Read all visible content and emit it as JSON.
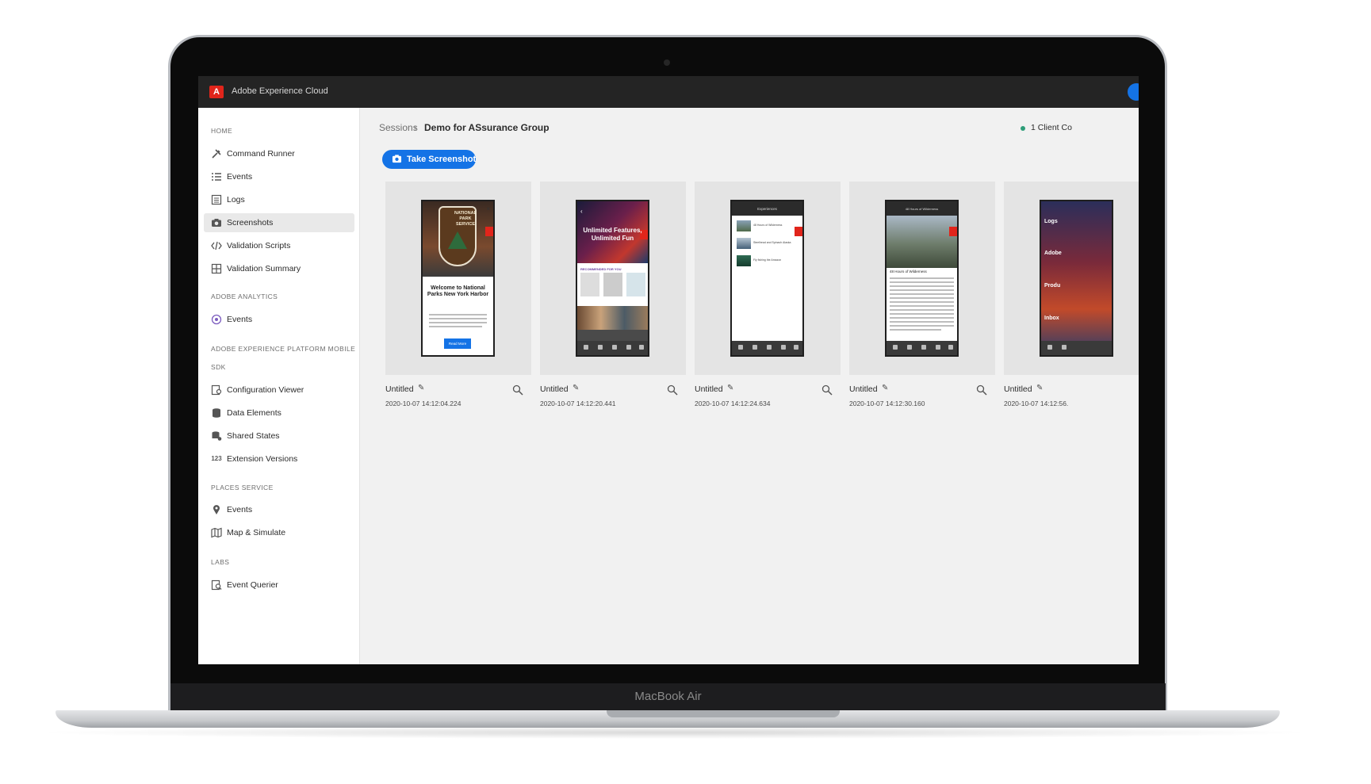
{
  "device": {
    "label": "MacBook Air"
  },
  "app": {
    "title": "Adobe Experience Cloud",
    "logo_letter": "A"
  },
  "sidebar": {
    "sections": [
      {
        "heading": "HOME",
        "items": [
          {
            "label": "Command Runner",
            "icon": "tools-icon"
          },
          {
            "label": "Events",
            "icon": "list-icon"
          },
          {
            "label": "Logs",
            "icon": "logs-icon"
          },
          {
            "label": "Screenshots",
            "icon": "camera-icon",
            "active": true
          },
          {
            "label": "Validation Scripts",
            "icon": "code-icon"
          },
          {
            "label": "Validation Summary",
            "icon": "summary-icon"
          }
        ]
      },
      {
        "heading": "ADOBE ANALYTICS",
        "items": [
          {
            "label": "Events",
            "icon": "analytics-icon"
          }
        ]
      },
      {
        "heading": "ADOBE EXPERIENCE PLATFORM MOBILE",
        "heading2": "SDK",
        "items": [
          {
            "label": "Configuration Viewer",
            "icon": "config-icon"
          },
          {
            "label": "Data Elements",
            "icon": "database-icon"
          },
          {
            "label": "Shared States",
            "icon": "shared-icon"
          },
          {
            "label": "Extension Versions",
            "icon": "number-icon",
            "glyph": "123"
          }
        ]
      },
      {
        "heading": "PLACES SERVICE",
        "items": [
          {
            "label": "Events",
            "icon": "pin-icon"
          },
          {
            "label": "Map & Simulate",
            "icon": "map-icon"
          }
        ]
      },
      {
        "heading": "LABS",
        "items": [
          {
            "label": "Event Querier",
            "icon": "query-icon"
          }
        ]
      }
    ]
  },
  "breadcrumb": {
    "root": "Sessions",
    "separator": "›",
    "current": "Demo for ASsurance Group"
  },
  "status": {
    "text": "1 Client Co",
    "color": "#2d9d78"
  },
  "toolbar": {
    "screenshot_label": "Take Screenshot"
  },
  "screenshots": [
    {
      "title": "Untitled",
      "timestamp": "2020-10-07 14:12:04.224",
      "texts": {
        "badge1": "NATIONAL",
        "badge2": "PARK",
        "badge3": "SERVICE",
        "heading": "Welcome to National Parks New York Harbor",
        "button": "Read More"
      }
    },
    {
      "title": "Untitled",
      "timestamp": "2020-10-07 14:12:20.441",
      "texts": {
        "hero": "Unlimited Features, Unlimited Fun",
        "section": "RECOMMENDED FOR YOU"
      }
    },
    {
      "title": "Untitled",
      "timestamp": "2020-10-07 14:12:24.634",
      "texts": {
        "header": "Experiences",
        "row1": "48 Hours of Wilderness",
        "row2": "Steelhead and Spinach Alaska",
        "row3": "Fly fishing the Amazon"
      }
    },
    {
      "title": "Untitled",
      "timestamp": "2020-10-07 14:12:30.160",
      "texts": {
        "header": "48 Hours of Wilderness",
        "caption": "48 Hours of Wilderness"
      }
    },
    {
      "title": "Untitled",
      "timestamp": "2020-10-07 14:12:56.",
      "texts": {
        "m1": "Logs",
        "m2": "Adobe",
        "m3": "Produ",
        "m4": "Inbox"
      }
    }
  ],
  "colors": {
    "accent": "#1473e6",
    "brand": "#e1251b",
    "topbar": "#242424"
  }
}
